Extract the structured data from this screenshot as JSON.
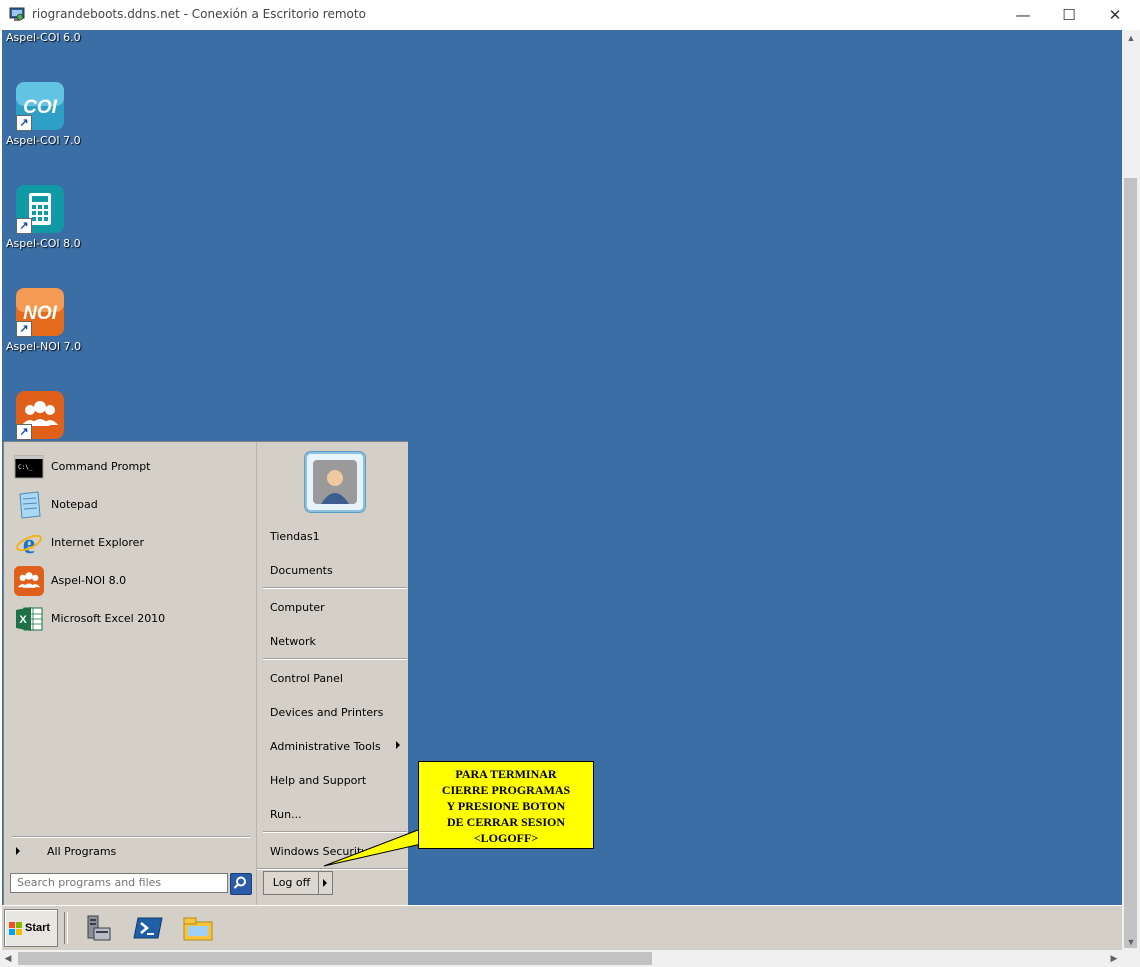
{
  "window": {
    "title": "riograndeboots.ddns.net - Conexión a Escritorio remoto",
    "minimize": "—",
    "maximize": "☐",
    "close": "✕"
  },
  "desktop_icons": [
    {
      "label": "Aspel-COI 6.0",
      "icon": "aspel-coi-icon"
    },
    {
      "label": "Aspel-COI 7.0",
      "icon": "aspel-coi-icon",
      "badge": "COI"
    },
    {
      "label": "Aspel-COI 8.0",
      "icon": "calculator-icon"
    },
    {
      "label": "Aspel-NOI 7.0",
      "icon": "aspel-noi-icon",
      "badge": "NOI"
    },
    {
      "label": "",
      "icon": "aspel-noi8-icon"
    }
  ],
  "start_menu": {
    "programs": [
      {
        "label": "Command Prompt",
        "icon": "command-prompt-icon"
      },
      {
        "label": "Notepad",
        "icon": "notepad-icon"
      },
      {
        "label": "Internet Explorer",
        "icon": "internet-explorer-icon"
      },
      {
        "label": "Aspel-NOI 8.0",
        "icon": "aspel-noi8-icon"
      },
      {
        "label": "Microsoft Excel 2010",
        "icon": "excel-icon"
      }
    ],
    "all_programs": "All Programs",
    "search_placeholder": "Search programs and files",
    "places": {
      "user": "Tiendas1",
      "documents": "Documents",
      "computer": "Computer",
      "network": "Network",
      "control_panel": "Control Panel",
      "devices": "Devices and Printers",
      "admin_tools": "Administrative Tools",
      "help": "Help and Support",
      "run": "Run...",
      "security": "Windows Security"
    },
    "logoff": "Log off"
  },
  "taskbar": {
    "start": "Start",
    "icons": [
      "server-manager-icon",
      "powershell-icon",
      "file-explorer-icon"
    ]
  },
  "callout": {
    "lines": [
      "PARA TERMINAR",
      "CIERRE PROGRAMAS",
      "Y PRESIONE BOTON",
      "DE CERRAR SESION",
      "<LOGOFF>"
    ],
    "color": "#ffff00"
  },
  "colors": {
    "desktop": "#3a6ea5",
    "classic_gray": "#d4d0c8"
  }
}
